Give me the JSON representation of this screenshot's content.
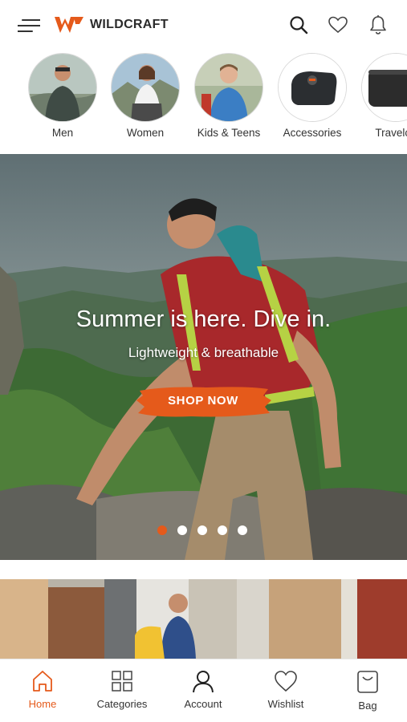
{
  "header": {
    "brand_name": "WILDCRAFT",
    "brand_color": "#e55a1b",
    "icons": [
      "menu-icon",
      "search-icon",
      "heart-icon",
      "bell-icon"
    ]
  },
  "categories": [
    {
      "label": "Men"
    },
    {
      "label": "Women"
    },
    {
      "label": "Kids & Teens"
    },
    {
      "label": "Accessories"
    },
    {
      "label": "Travelca"
    }
  ],
  "hero": {
    "title": "Summer is here. Dive in.",
    "subtitle": "Lightweight & breathable",
    "cta_label": "SHOP NOW",
    "carousel_total": 5,
    "carousel_active": 1
  },
  "bottom_nav": [
    {
      "label": "Home",
      "icon": "home-icon",
      "active": true
    },
    {
      "label": "Categories",
      "icon": "grid-icon",
      "active": false
    },
    {
      "label": "Account",
      "icon": "user-icon",
      "active": false
    },
    {
      "label": "Wishlist",
      "icon": "heart-icon",
      "active": false
    },
    {
      "label": "Bag",
      "icon": "bag-icon",
      "active": false
    }
  ],
  "colors": {
    "accent": "#e55a1b",
    "text": "#333333"
  }
}
